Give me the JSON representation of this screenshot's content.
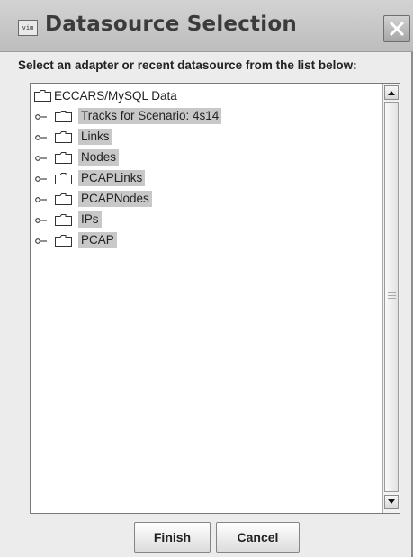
{
  "window": {
    "title": "Datasource Selection",
    "app_icon_text": "vim",
    "icons": {
      "app": "app-window-icon",
      "close": "close-icon"
    }
  },
  "instruction": "Select an adapter or recent datasource from the list below:",
  "tree": {
    "root": {
      "label": "ECCARS/MySQL Data",
      "icon": "folder-icon"
    },
    "items": [
      {
        "label": "Tracks for Scenario: 4s14",
        "icon": "folder-icon",
        "toggle_icon": "collapsed-toggle-icon",
        "selected": true
      },
      {
        "label": "Links",
        "icon": "folder-icon",
        "toggle_icon": "collapsed-toggle-icon",
        "selected": true
      },
      {
        "label": "Nodes",
        "icon": "folder-icon",
        "toggle_icon": "collapsed-toggle-icon",
        "selected": true
      },
      {
        "label": "PCAPLinks",
        "icon": "folder-icon",
        "toggle_icon": "collapsed-toggle-icon",
        "selected": true
      },
      {
        "label": "PCAPNodes",
        "icon": "folder-icon",
        "toggle_icon": "collapsed-toggle-icon",
        "selected": true
      },
      {
        "label": "IPs",
        "icon": "folder-icon",
        "toggle_icon": "collapsed-toggle-icon",
        "selected": true
      },
      {
        "label": "PCAP",
        "icon": "folder-icon",
        "toggle_icon": "collapsed-toggle-icon",
        "selected": true
      }
    ]
  },
  "scrollbar": {
    "up_icon": "scroll-up-arrow-icon",
    "down_icon": "scroll-down-arrow-icon"
  },
  "buttons": {
    "finish": "Finish",
    "cancel": "Cancel"
  },
  "colors": {
    "selection": "#c8c8c8",
    "titlebar": "#c9c9c9",
    "panel": "#ffffff"
  }
}
